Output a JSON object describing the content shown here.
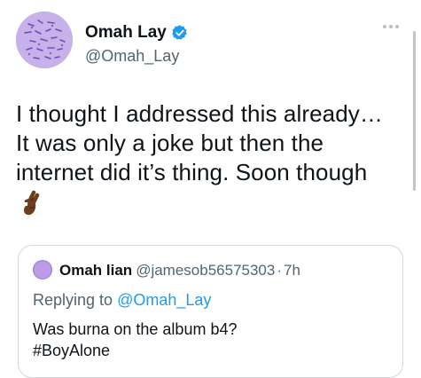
{
  "author": {
    "display_name": "Omah Lay",
    "handle": "@Omah_Lay",
    "verified": true,
    "avatar_color": "#c6b1ea"
  },
  "more_icon": "more-horizontal-icon",
  "tweet": {
    "lines": [
      "I thought I addressed this already…",
      "It was only a joke but then the",
      "internet did it’s thing. Soon though"
    ],
    "emoji": "crossed-fingers-emoji"
  },
  "quoted": {
    "display_name": "Omah lian",
    "handle": "@jamesob56575303",
    "separator": "·",
    "time": "7h",
    "replying_prefix": "Replying to",
    "replying_to": "@Omah_Lay",
    "lines": [
      "Was burna on the album b4?",
      "#BoyAlone"
    ]
  },
  "colors": {
    "accent": "#1d9bf0",
    "secondary_text": "#536471",
    "border": "#cfd9de"
  }
}
